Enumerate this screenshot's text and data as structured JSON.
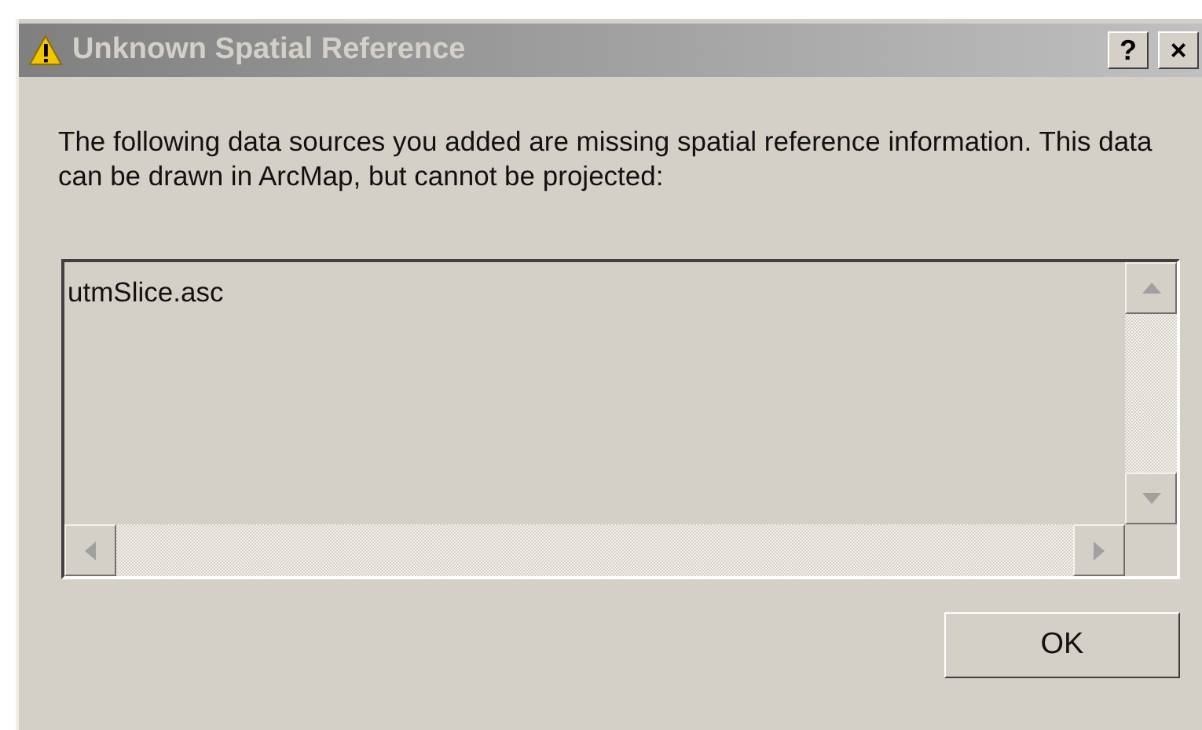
{
  "window": {
    "title": "Unknown Spatial Reference",
    "help_button": "?",
    "close_button": "×"
  },
  "message": "The following data sources you added are missing spatial reference information. This data can be drawn in ArcMap, but cannot be projected:",
  "list": {
    "items": [
      "utmSlice.asc"
    ]
  },
  "buttons": [
    "OK"
  ]
}
